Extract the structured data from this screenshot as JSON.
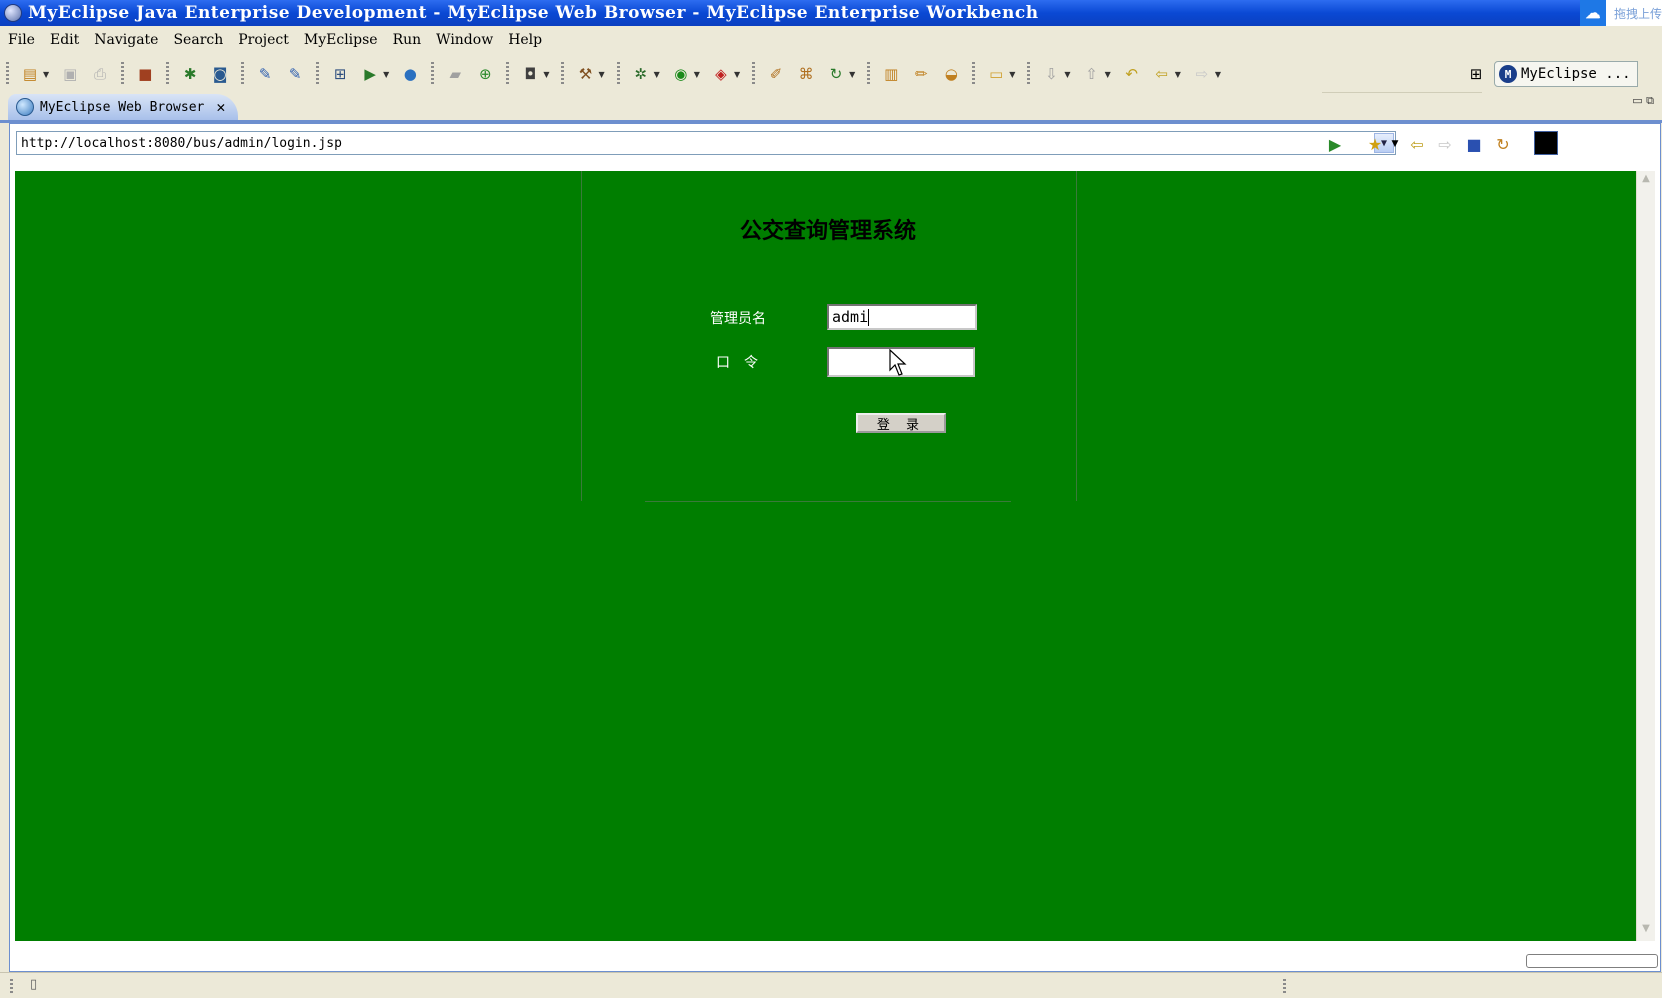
{
  "window": {
    "title": "MyEclipse Java Enterprise Development - MyEclipse Web Browser - MyEclipse Enterprise Workbench",
    "tray_text": "拖拽上传"
  },
  "menu": [
    "File",
    "Edit",
    "Navigate",
    "Search",
    "Project",
    "MyEclipse",
    "Run",
    "Window",
    "Help"
  ],
  "toolbar": {
    "perspective_label": "MyEclipse ...",
    "icons": [
      "new-icon",
      "save-icon",
      "print-icon",
      "package-icon",
      "deploy-icon",
      "server-icon",
      "jsp-icon",
      "web-icon",
      "hierarchy-icon",
      "run-server-icon",
      "globe-icon",
      "open-folder-icon",
      "add-icon",
      "camera-icon",
      "tool-icon",
      "debug-icon",
      "run-icon",
      "external-tools-icon",
      "new-wizard-icon",
      "tree-icon",
      "refresh-icon",
      "open-type-icon",
      "pencil-icon",
      "open-task-icon",
      "folder-icon",
      "next-annotation-icon",
      "prev-annotation-icon",
      "last-edit-icon",
      "back-icon",
      "forward-icon"
    ]
  },
  "editor_tab": {
    "label": "MyEclipse Web Browser"
  },
  "browser": {
    "url": "http://localhost:8080/bus/admin/login.jsp",
    "background": "#007e00"
  },
  "login_page": {
    "title": "公交查询管理系统",
    "username_label": "管理员名",
    "username_value": "admi",
    "password_label": "口　令",
    "password_value": "",
    "submit_label": "登 录"
  }
}
